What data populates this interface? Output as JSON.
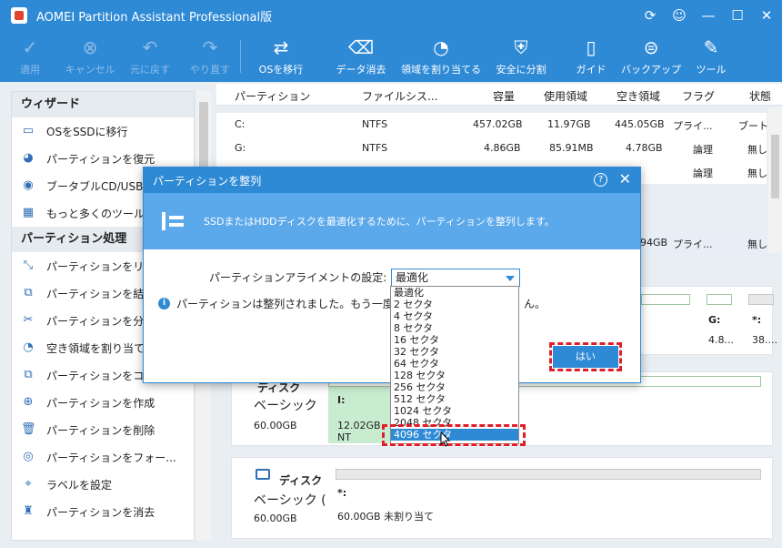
{
  "app": {
    "title": "AOMEI Partition Assistant Professional版"
  },
  "window_controls": [
    "⟳",
    "☺",
    "—",
    "☐",
    "✕"
  ],
  "toolbar": [
    {
      "label": "適用",
      "icon": "check-icon",
      "glyph": "✓",
      "enabled": false
    },
    {
      "label": "キャンセル",
      "icon": "cancel-icon",
      "glyph": "⊗",
      "enabled": false
    },
    {
      "label": "元に戻す",
      "icon": "undo-icon",
      "glyph": "↶",
      "enabled": false
    },
    {
      "label": "やり直す",
      "icon": "redo-icon",
      "glyph": "↷",
      "enabled": false
    },
    {
      "label": "OSを移行",
      "icon": "migrate-os-icon",
      "glyph": "⇄",
      "enabled": true
    },
    {
      "label": "データ消去",
      "icon": "wipe-data-icon",
      "glyph": "⌫",
      "enabled": true
    },
    {
      "label": "領域を割り当てる",
      "icon": "allocate-space-icon",
      "glyph": "◔",
      "enabled": true
    },
    {
      "label": "安全に分割",
      "icon": "safe-split-icon",
      "glyph": "⛨",
      "enabled": true
    },
    {
      "label": "ガイド",
      "icon": "guide-icon",
      "glyph": "▯",
      "enabled": true
    },
    {
      "label": "バックアップ",
      "icon": "backup-icon",
      "glyph": "⊜",
      "enabled": true
    },
    {
      "label": "ツール",
      "icon": "tools-icon",
      "glyph": "✎",
      "enabled": true
    }
  ],
  "sidebar": {
    "wizard_title": "ウィザード",
    "wizard_items": [
      {
        "label": "OSをSSDに移行",
        "icon": "migrate-ssd-icon",
        "glyph": "▭"
      },
      {
        "label": "パーティションを復元",
        "icon": "restore-partition-icon",
        "glyph": "◕"
      },
      {
        "label": "ブータブルCD/USBを",
        "icon": "bootable-media-icon",
        "glyph": "◉"
      },
      {
        "label": "もっと多くのツール",
        "icon": "more-tools-icon",
        "glyph": "▦"
      }
    ],
    "partition_title": "パーティション処理",
    "partition_items": [
      {
        "label": "パーティションをリ",
        "icon": "resize-partition-icon",
        "glyph": "⤡"
      },
      {
        "label": "パーティションを結",
        "icon": "merge-partition-icon",
        "glyph": "⧉"
      },
      {
        "label": "パーティションを分",
        "icon": "split-partition-icon",
        "glyph": "✂"
      },
      {
        "label": "空き領域を割り当て",
        "icon": "allocate-free-icon",
        "glyph": "◔"
      },
      {
        "label": "パーティションをコピー",
        "icon": "copy-partition-icon",
        "glyph": "⧉"
      },
      {
        "label": "パーティションを作成",
        "icon": "create-partition-icon",
        "glyph": "⊕"
      },
      {
        "label": "パーティションを削除",
        "icon": "delete-partition-icon",
        "glyph": "🗑"
      },
      {
        "label": "パーティションをフォー...",
        "icon": "format-partition-icon",
        "glyph": "◎"
      },
      {
        "label": "ラベルを設定",
        "icon": "label-icon",
        "glyph": "⌖"
      },
      {
        "label": "パーティションを消去",
        "icon": "wipe-partition-icon",
        "glyph": "♜"
      }
    ]
  },
  "table": {
    "headers": [
      "パーティション",
      "ファイルシス...",
      "容量",
      "使用領域",
      "空き領域",
      "フラグ",
      "状態"
    ],
    "rows": [
      {
        "partition": "C:",
        "fs": "NTFS",
        "capacity": "457.02GB",
        "used": "11.97GB",
        "free": "445.05GB",
        "flag": "プライ...",
        "status": "ブート"
      },
      {
        "partition": "G:",
        "fs": "NTFS",
        "capacity": "4.86GB",
        "used": "85.91MB",
        "free": "4.78GB",
        "flag": "論理",
        "status": "無し"
      },
      {
        "partition": "",
        "fs": "",
        "capacity": "",
        "used": "",
        "free": "",
        "flag": "論理",
        "status": "無し"
      },
      {
        "partition": "",
        "fs": "",
        "capacity": "",
        "used": "",
        "free": "94GB",
        "flag": "プライ...",
        "status": "無し"
      }
    ]
  },
  "disks": {
    "top_right": {
      "g_label": "G:",
      "g_size": "4.8...",
      "star_label": "*:",
      "star_size": "38...."
    },
    "disk2": {
      "title": "ディスク",
      "type": "ベーシック",
      "size": "60.00GB",
      "part_label": "I:",
      "part_text": "12.02GB NT"
    },
    "disk3": {
      "title": "ディスク",
      "type": "ベーシック (",
      "size": "60.00GB",
      "part_label": "*:",
      "part_text": "60.00GB 未割り当て"
    }
  },
  "dialog": {
    "title": "パーティションを整列",
    "help": "?",
    "banner_text": "SSDまたはHDDディスクを最適化するために、パーティションを整列します。",
    "setting_label": "パーティションアライメントの設定:",
    "selected_value": "最適化",
    "info_text": "パーティションは整列されました。もう一度",
    "info_tail": "ん。",
    "ok_label": "はい",
    "options": [
      "最適化",
      "2 セクタ",
      "4 セクタ",
      "8 セクタ",
      "16 セクタ",
      "32 セクタ",
      "64 セクタ",
      "128 セクタ",
      "256 セクタ",
      "512 セクタ",
      "1024 セクタ",
      "2048 セクタ",
      "4096 セクタ"
    ],
    "highlighted_option": "4096 セクタ"
  },
  "colors": {
    "accent": "#2f8ad6",
    "banner": "#5ba8ea",
    "highlight": "#e01e2a",
    "partition_fill": "#c8ecd0"
  }
}
